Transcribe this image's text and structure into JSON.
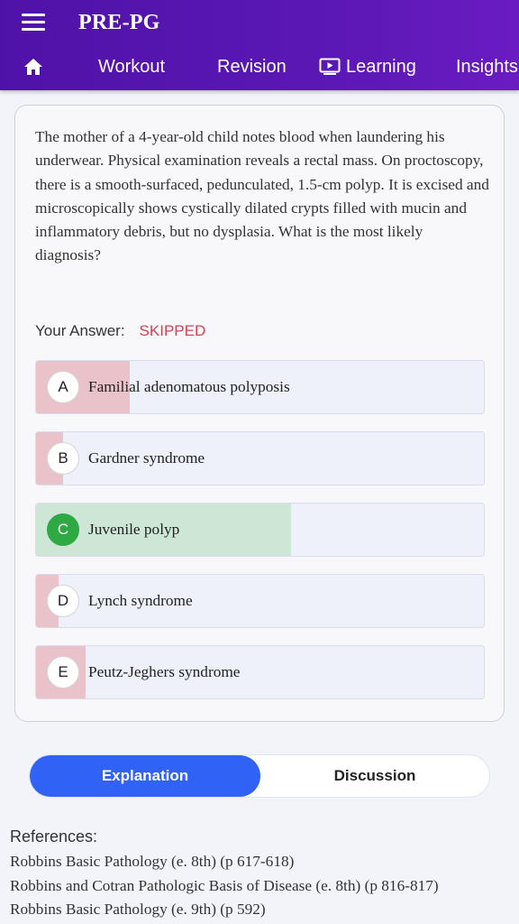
{
  "header": {
    "title": "PRE-PG",
    "menu_icon": "hamburger-icon",
    "nav": {
      "home_icon": "home-icon",
      "items": [
        {
          "label": "Workout"
        },
        {
          "label": "Revision"
        },
        {
          "label": "Learning",
          "icon": "tv-play-icon"
        },
        {
          "label": "Insights"
        }
      ]
    }
  },
  "question": {
    "text": "The mother of a 4-year-old child notes blood when laundering his underwear. Physical examination reveals a rectal mass. On proctoscopy, there is a smooth-surfaced, pedunculated, 1.5-cm polyp. It is excised and microscopically shows cystically dilated crypts filled with mucin and inflammatory debris, but no dysplasia. What is the most likely diagnosis?",
    "answer_label": "Your Answer:",
    "answer_value": "SKIPPED",
    "options": [
      {
        "letter": "A",
        "text": "Familial adenomatous polyposis",
        "fill_fraction": 0.21,
        "status": "incorrect"
      },
      {
        "letter": "B",
        "text": "Gardner syndrome",
        "fill_fraction": 0.06,
        "status": "incorrect"
      },
      {
        "letter": "C",
        "text": "Juvenile polyp",
        "fill_fraction": 0.57,
        "status": "correct"
      },
      {
        "letter": "D",
        "text": "Lynch syndrome",
        "fill_fraction": 0.05,
        "status": "incorrect"
      },
      {
        "letter": "E",
        "text": "Peutz-Jeghers syndrome",
        "fill_fraction": 0.11,
        "status": "incorrect"
      }
    ]
  },
  "tabs": {
    "explanation": "Explanation",
    "discussion": "Discussion",
    "active": "explanation"
  },
  "references": {
    "title": "References:",
    "items": [
      "Robbins Basic Pathology (e. 8th) (p 617-618)",
      "Robbins and Cotran Pathologic Basis of Disease (e. 8th) (p 816-817)",
      "Robbins Basic Pathology (e. 9th) (p 592)"
    ]
  },
  "colors": {
    "header_bg": "#5a17b4",
    "incorrect_fill": "#eac2ca",
    "correct_fill": "#cde6d6",
    "correct_badge": "#2ea943",
    "skipped_text": "#d6424f",
    "active_tab": "#2f62f5"
  }
}
